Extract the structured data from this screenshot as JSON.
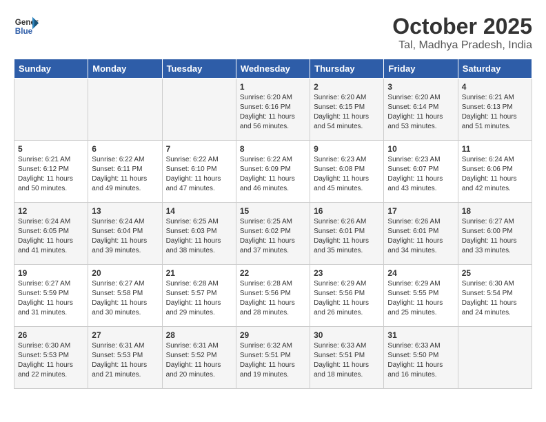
{
  "logo": {
    "line1": "General",
    "line2": "Blue"
  },
  "title": "October 2025",
  "subtitle": "Tal, Madhya Pradesh, India",
  "headers": [
    "Sunday",
    "Monday",
    "Tuesday",
    "Wednesday",
    "Thursday",
    "Friday",
    "Saturday"
  ],
  "weeks": [
    [
      {
        "day": "",
        "info": ""
      },
      {
        "day": "",
        "info": ""
      },
      {
        "day": "",
        "info": ""
      },
      {
        "day": "1",
        "info": "Sunrise: 6:20 AM\nSunset: 6:16 PM\nDaylight: 11 hours\nand 56 minutes."
      },
      {
        "day": "2",
        "info": "Sunrise: 6:20 AM\nSunset: 6:15 PM\nDaylight: 11 hours\nand 54 minutes."
      },
      {
        "day": "3",
        "info": "Sunrise: 6:20 AM\nSunset: 6:14 PM\nDaylight: 11 hours\nand 53 minutes."
      },
      {
        "day": "4",
        "info": "Sunrise: 6:21 AM\nSunset: 6:13 PM\nDaylight: 11 hours\nand 51 minutes."
      }
    ],
    [
      {
        "day": "5",
        "info": "Sunrise: 6:21 AM\nSunset: 6:12 PM\nDaylight: 11 hours\nand 50 minutes."
      },
      {
        "day": "6",
        "info": "Sunrise: 6:22 AM\nSunset: 6:11 PM\nDaylight: 11 hours\nand 49 minutes."
      },
      {
        "day": "7",
        "info": "Sunrise: 6:22 AM\nSunset: 6:10 PM\nDaylight: 11 hours\nand 47 minutes."
      },
      {
        "day": "8",
        "info": "Sunrise: 6:22 AM\nSunset: 6:09 PM\nDaylight: 11 hours\nand 46 minutes."
      },
      {
        "day": "9",
        "info": "Sunrise: 6:23 AM\nSunset: 6:08 PM\nDaylight: 11 hours\nand 45 minutes."
      },
      {
        "day": "10",
        "info": "Sunrise: 6:23 AM\nSunset: 6:07 PM\nDaylight: 11 hours\nand 43 minutes."
      },
      {
        "day": "11",
        "info": "Sunrise: 6:24 AM\nSunset: 6:06 PM\nDaylight: 11 hours\nand 42 minutes."
      }
    ],
    [
      {
        "day": "12",
        "info": "Sunrise: 6:24 AM\nSunset: 6:05 PM\nDaylight: 11 hours\nand 41 minutes."
      },
      {
        "day": "13",
        "info": "Sunrise: 6:24 AM\nSunset: 6:04 PM\nDaylight: 11 hours\nand 39 minutes."
      },
      {
        "day": "14",
        "info": "Sunrise: 6:25 AM\nSunset: 6:03 PM\nDaylight: 11 hours\nand 38 minutes."
      },
      {
        "day": "15",
        "info": "Sunrise: 6:25 AM\nSunset: 6:02 PM\nDaylight: 11 hours\nand 37 minutes."
      },
      {
        "day": "16",
        "info": "Sunrise: 6:26 AM\nSunset: 6:01 PM\nDaylight: 11 hours\nand 35 minutes."
      },
      {
        "day": "17",
        "info": "Sunrise: 6:26 AM\nSunset: 6:01 PM\nDaylight: 11 hours\nand 34 minutes."
      },
      {
        "day": "18",
        "info": "Sunrise: 6:27 AM\nSunset: 6:00 PM\nDaylight: 11 hours\nand 33 minutes."
      }
    ],
    [
      {
        "day": "19",
        "info": "Sunrise: 6:27 AM\nSunset: 5:59 PM\nDaylight: 11 hours\nand 31 minutes."
      },
      {
        "day": "20",
        "info": "Sunrise: 6:27 AM\nSunset: 5:58 PM\nDaylight: 11 hours\nand 30 minutes."
      },
      {
        "day": "21",
        "info": "Sunrise: 6:28 AM\nSunset: 5:57 PM\nDaylight: 11 hours\nand 29 minutes."
      },
      {
        "day": "22",
        "info": "Sunrise: 6:28 AM\nSunset: 5:56 PM\nDaylight: 11 hours\nand 28 minutes."
      },
      {
        "day": "23",
        "info": "Sunrise: 6:29 AM\nSunset: 5:56 PM\nDaylight: 11 hours\nand 26 minutes."
      },
      {
        "day": "24",
        "info": "Sunrise: 6:29 AM\nSunset: 5:55 PM\nDaylight: 11 hours\nand 25 minutes."
      },
      {
        "day": "25",
        "info": "Sunrise: 6:30 AM\nSunset: 5:54 PM\nDaylight: 11 hours\nand 24 minutes."
      }
    ],
    [
      {
        "day": "26",
        "info": "Sunrise: 6:30 AM\nSunset: 5:53 PM\nDaylight: 11 hours\nand 22 minutes."
      },
      {
        "day": "27",
        "info": "Sunrise: 6:31 AM\nSunset: 5:53 PM\nDaylight: 11 hours\nand 21 minutes."
      },
      {
        "day": "28",
        "info": "Sunrise: 6:31 AM\nSunset: 5:52 PM\nDaylight: 11 hours\nand 20 minutes."
      },
      {
        "day": "29",
        "info": "Sunrise: 6:32 AM\nSunset: 5:51 PM\nDaylight: 11 hours\nand 19 minutes."
      },
      {
        "day": "30",
        "info": "Sunrise: 6:33 AM\nSunset: 5:51 PM\nDaylight: 11 hours\nand 18 minutes."
      },
      {
        "day": "31",
        "info": "Sunrise: 6:33 AM\nSunset: 5:50 PM\nDaylight: 11 hours\nand 16 minutes."
      },
      {
        "day": "",
        "info": ""
      }
    ]
  ]
}
